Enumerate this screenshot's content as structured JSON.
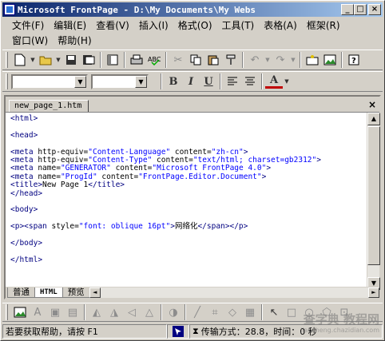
{
  "window": {
    "title": "Microsoft FrontPage - D:\\My Documents\\My Webs",
    "minimize": "_",
    "maximize": "□",
    "close": "×"
  },
  "menu": {
    "row1": [
      "文件(F)",
      "编辑(E)",
      "查看(V)",
      "插入(I)",
      "格式(O)",
      "工具(T)",
      "表格(A)",
      "框架(R)"
    ],
    "row2": [
      "窗口(W)",
      "帮助(H)"
    ]
  },
  "icons": {
    "new": "new-page-icon",
    "open": "open-folder-icon",
    "save": "save-icon",
    "publish": "publish-icon",
    "folder_list": "folder-list-icon",
    "print": "print-icon",
    "spelling": "spelling-icon",
    "cut": "cut-icon",
    "copy": "copy-icon",
    "paste": "paste-icon",
    "format_painter": "format-painter-icon",
    "undo": "undo-icon",
    "redo": "redo-icon",
    "web_component": "web-component-icon",
    "insert_picture": "insert-picture-icon",
    "help": "help-icon"
  },
  "format_bar": {
    "style_value": "",
    "font_value": "",
    "bold": "B",
    "italic": "I",
    "underline": "U",
    "font_color": "A"
  },
  "document": {
    "tab_name": "new_page_1.htm",
    "close": "×",
    "code_lines": [
      [
        [
          "tag",
          "<html>"
        ]
      ],
      [],
      [
        [
          "tag",
          "<head>"
        ]
      ],
      [],
      [
        [
          "tag",
          "<meta "
        ],
        [
          "attr",
          "http-equiv="
        ],
        [
          "str",
          "\"Content-Language\""
        ],
        [
          "attr",
          " content="
        ],
        [
          "str",
          "\"zh-cn\""
        ],
        [
          "tag",
          ">"
        ]
      ],
      [
        [
          "tag",
          "<meta "
        ],
        [
          "attr",
          "http-equiv="
        ],
        [
          "str",
          "\"Content-Type\""
        ],
        [
          "attr",
          " content="
        ],
        [
          "str",
          "\"text/html; charset=gb2312\""
        ],
        [
          "tag",
          ">"
        ]
      ],
      [
        [
          "tag",
          "<meta "
        ],
        [
          "attr",
          "name="
        ],
        [
          "str",
          "\"GENERATOR\""
        ],
        [
          "attr",
          " content="
        ],
        [
          "str",
          "\"Microsoft FrontPage 4.0\""
        ],
        [
          "tag",
          ">"
        ]
      ],
      [
        [
          "tag",
          "<meta "
        ],
        [
          "attr",
          "name="
        ],
        [
          "str",
          "\"ProgId\""
        ],
        [
          "attr",
          " content="
        ],
        [
          "str",
          "\"FrontPage.Editor.Document\""
        ],
        [
          "tag",
          ">"
        ]
      ],
      [
        [
          "tag",
          "<title>"
        ],
        [
          "txt",
          "New Page 1"
        ],
        [
          "tag",
          "</title>"
        ]
      ],
      [
        [
          "tag",
          "</head>"
        ]
      ],
      [],
      [
        [
          "tag",
          "<body>"
        ]
      ],
      [],
      [
        [
          "tag",
          "<p><span "
        ],
        [
          "attr",
          "style="
        ],
        [
          "str",
          "\"font: oblique 16pt\""
        ],
        [
          "tag",
          ">"
        ],
        [
          "txt",
          "网络化"
        ],
        [
          "tag",
          "</span></p>"
        ]
      ],
      [],
      [
        [
          "tag",
          "</body>"
        ]
      ],
      [],
      [
        [
          "tag",
          "</html>"
        ]
      ]
    ]
  },
  "view_tabs": [
    "普通",
    "HTML",
    "预览"
  ],
  "status": {
    "help_text": "若要获取帮助，请按 F1",
    "transfer": "传输方式：28.8，时间：0 秒"
  },
  "watermark": {
    "line1": "查字典 教程网",
    "line2": "jiaocheng.chazidian.com"
  }
}
